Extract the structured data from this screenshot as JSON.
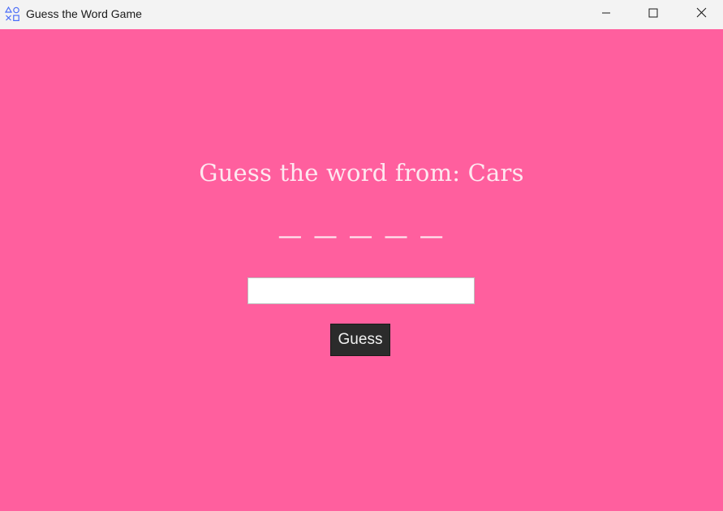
{
  "window": {
    "title": "Guess the Word Game",
    "icon": "app-shapes-icon",
    "controls": [
      "minimize-icon",
      "maximize-icon",
      "close-icon"
    ]
  },
  "game": {
    "prompt_prefix": "Guess the word from: ",
    "category": "Cars",
    "blanks": "— — — — —",
    "input_value": "",
    "guess_label": "Guess"
  },
  "colors": {
    "background": "#ff5f9e",
    "text": "#fde8f0",
    "button_bg": "#2b2b2b",
    "button_text": "#f2f2f2"
  }
}
